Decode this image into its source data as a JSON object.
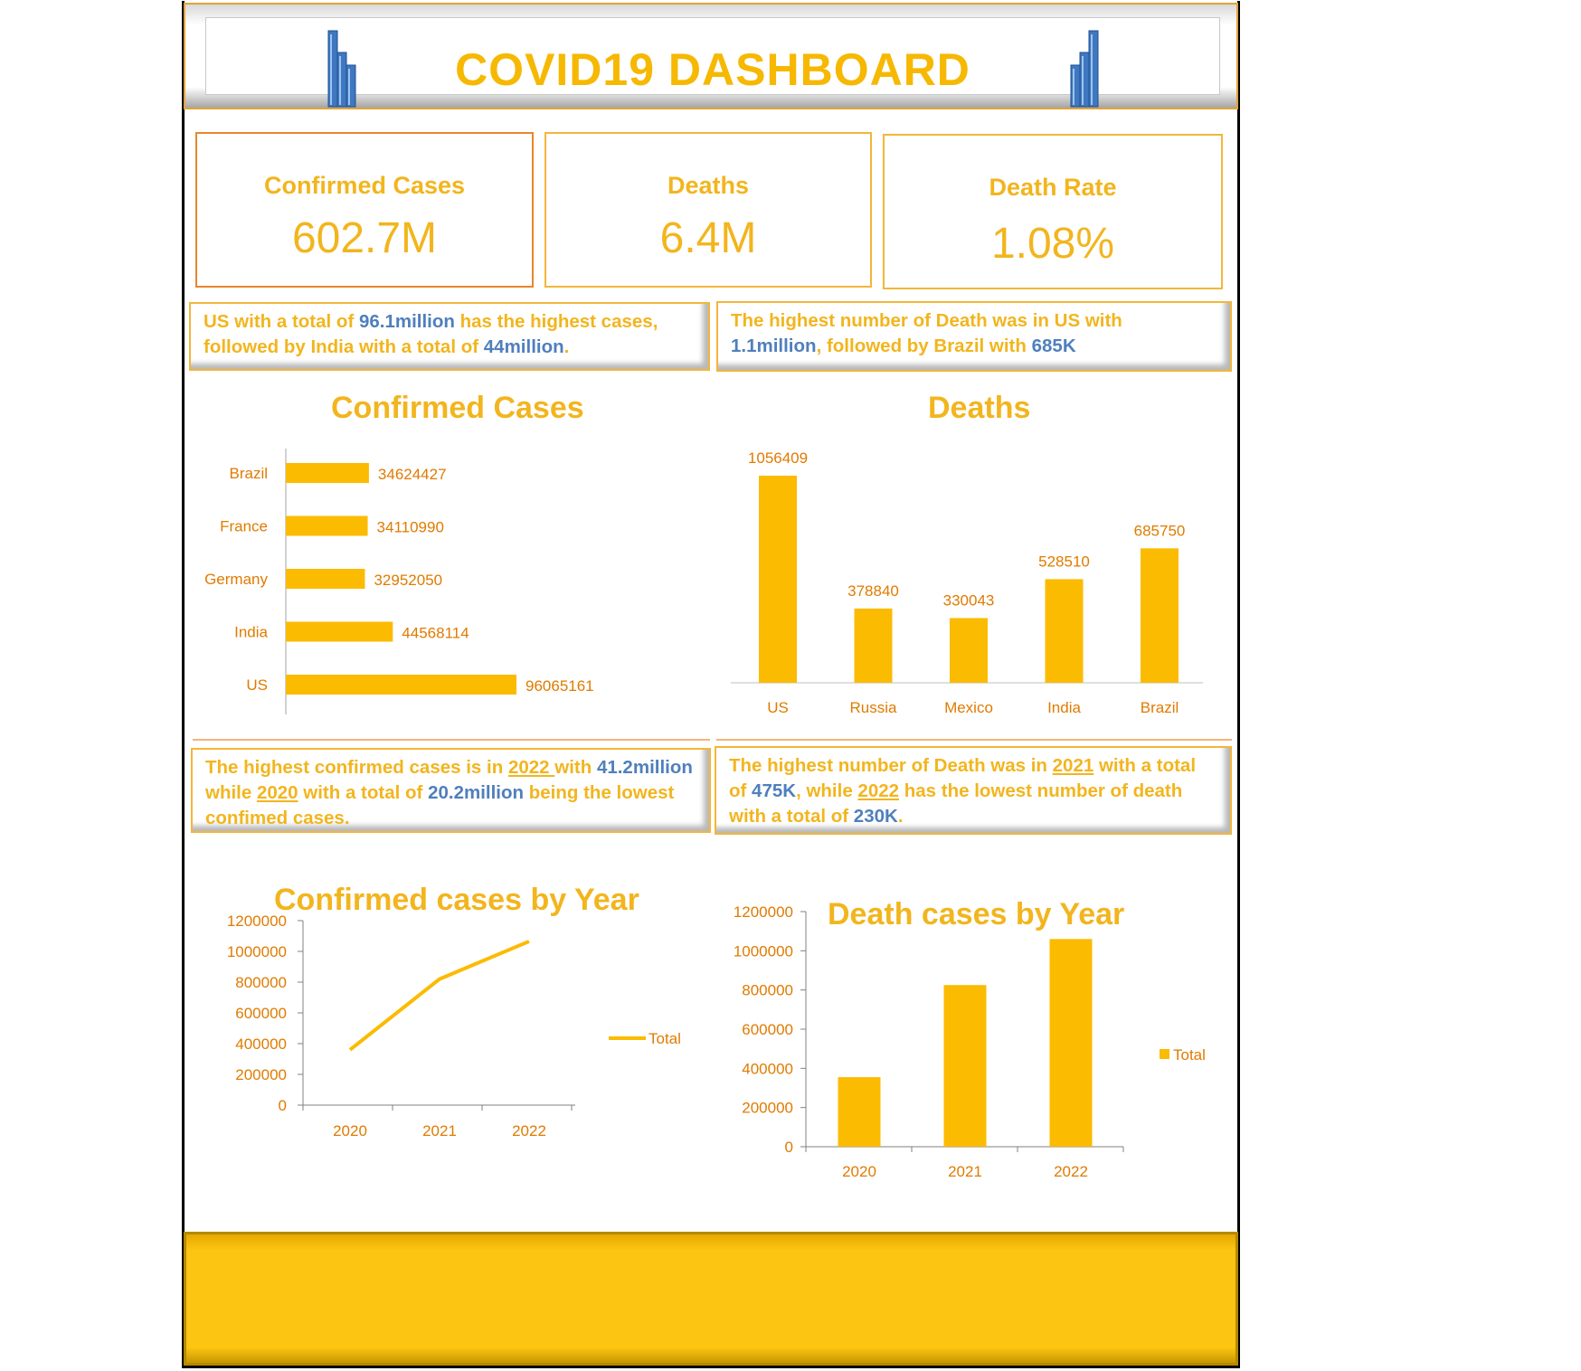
{
  "header": {
    "title": "COVID19 DASHBOARD"
  },
  "kpis": [
    {
      "label": "Confirmed Cases",
      "value": "602.7M"
    },
    {
      "label": "Deaths",
      "value": "6.4M"
    },
    {
      "label": "Death Rate",
      "value": "1.08%"
    }
  ],
  "notes": {
    "cases_top": {
      "a": "US with a total of ",
      "b": "96.1million",
      "c": " has the highest cases, followed by India with a total of ",
      "d": "44million",
      "e": "."
    },
    "deaths_top": {
      "a": "The highest number of Death was in US with ",
      "b": "1.1million",
      "c": ", followed by Brazil with ",
      "d": "685K"
    },
    "cases_year": {
      "a": "The highest confirmed cases is in ",
      "b": "2022 ",
      "c": "with ",
      "d": "41.2million",
      "e": " while  ",
      "f": "2020",
      "g": " with a total of ",
      "h": "20.2million",
      "i": " being the lowest confimed cases."
    },
    "deaths_year": {
      "a": "The highest number of Death was in ",
      "b": "2021",
      "c": " with a total of ",
      "d": "475K",
      "e": ", while ",
      "f": "2022",
      "g": " has the lowest number of death with a total of  ",
      "h": "230K",
      "i": "."
    }
  },
  "colors": {
    "accent": "#f2b51e",
    "bar": "#fbbb00",
    "blue": "#4f7fbd",
    "axis_text": "#e07b00"
  },
  "chart_data": [
    {
      "type": "bar",
      "orientation": "horizontal",
      "title": "Confirmed Cases",
      "categories": [
        "Brazil",
        "France",
        "Germany",
        "India",
        "US"
      ],
      "values": [
        34624427,
        34110990,
        32952050,
        44568114,
        96065161
      ],
      "data_labels": true
    },
    {
      "type": "bar",
      "title": "Deaths",
      "categories": [
        "US",
        "Russia",
        "Mexico",
        "India",
        "Brazil"
      ],
      "values": [
        1056409,
        378840,
        330043,
        528510,
        685750
      ],
      "data_labels": true
    },
    {
      "type": "line",
      "title": "Confirmed cases by Year",
      "categories": [
        "2020",
        "2021",
        "2022"
      ],
      "series": [
        {
          "name": "Total",
          "values": [
            360000,
            820000,
            1065000
          ]
        }
      ],
      "ylim": [
        0,
        1200000
      ],
      "yticks": [
        "0",
        "200000",
        "400000",
        "600000",
        "800000",
        "1000000",
        "1200000"
      ],
      "legend": "right"
    },
    {
      "type": "bar",
      "title": "Death cases by Year",
      "categories": [
        "2020",
        "2021",
        "2022"
      ],
      "series": [
        {
          "name": "Total",
          "values": [
            355000,
            825000,
            1060000
          ]
        }
      ],
      "ylim": [
        0,
        1200000
      ],
      "yticks": [
        "0",
        "200000",
        "400000",
        "600000",
        "800000",
        "1000000",
        "1200000"
      ],
      "legend": "right"
    }
  ]
}
